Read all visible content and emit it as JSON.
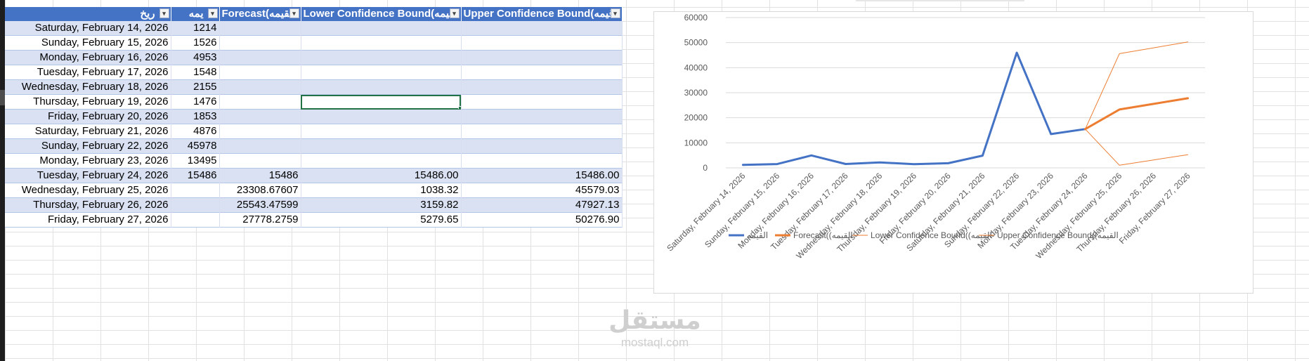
{
  "table": {
    "headers": [
      "ريخ",
      "يمه",
      "Forecast(لقيمه",
      "Lower Confidence Bound(قيمه",
      "Upper Confidence Bound(قيمه"
    ],
    "rows": [
      [
        "Saturday, February 14, 2026",
        "1214",
        "",
        "",
        ""
      ],
      [
        "Sunday, February 15, 2026",
        "1526",
        "",
        "",
        ""
      ],
      [
        "Monday, February 16, 2026",
        "4953",
        "",
        "",
        ""
      ],
      [
        "Tuesday, February 17, 2026",
        "1548",
        "",
        "",
        ""
      ],
      [
        "Wednesday, February 18, 2026",
        "2155",
        "",
        "",
        ""
      ],
      [
        "Thursday, February 19, 2026",
        "1476",
        "",
        "",
        ""
      ],
      [
        "Friday, February 20, 2026",
        "1853",
        "",
        "",
        ""
      ],
      [
        "Saturday, February 21, 2026",
        "4876",
        "",
        "",
        ""
      ],
      [
        "Sunday, February 22, 2026",
        "45978",
        "",
        "",
        ""
      ],
      [
        "Monday, February 23, 2026",
        "13495",
        "",
        "",
        ""
      ],
      [
        "Tuesday, February 24, 2026",
        "15486",
        "15486",
        "15486.00",
        "15486.00"
      ],
      [
        "Wednesday, February 25, 2026",
        "",
        "23308.67607",
        "1038.32",
        "45579.03"
      ],
      [
        "Thursday, February 26, 2026",
        "",
        "25543.47599",
        "3159.82",
        "47927.13"
      ],
      [
        "Friday, February 27, 2026",
        "",
        "27778.2759",
        "5279.65",
        "50276.90"
      ]
    ]
  },
  "watermark": {
    "logo": "مستقل",
    "text": "mostaql.com"
  },
  "chart_data": {
    "type": "line",
    "categories": [
      "Saturday, February 14, 2026",
      "Sunday, February 15, 2026",
      "Monday, February 16, 2026",
      "Tuesday, February 17, 2026",
      "Wednesday, February 18, 2026",
      "Thursday, February 19, 2026",
      "Friday, February 20, 2026",
      "Saturday, February 21, 2026",
      "Sunday, February 22, 2026",
      "Monday, February 23, 2026",
      "Tuesday, February 24, 2026",
      "Wednesday, February 25, 2026",
      "Thursday, February 26, 2026",
      "Friday, February 27, 2026"
    ],
    "ylim": [
      0,
      60000
    ],
    "yticks": [
      0,
      10000,
      20000,
      30000,
      40000,
      50000,
      60000
    ],
    "grid": true,
    "legend": "bottom",
    "series": [
      {
        "name": "القيمه",
        "color": "#4472c4",
        "width": 3,
        "values": [
          1214,
          1526,
          4953,
          1548,
          2155,
          1476,
          1853,
          4876,
          45978,
          13495,
          15486,
          null,
          null,
          null
        ]
      },
      {
        "name": "Forecast((القيمه",
        "color": "#ed7d31",
        "width": 3,
        "values": [
          null,
          null,
          null,
          null,
          null,
          null,
          null,
          null,
          null,
          null,
          15486,
          23308.67607,
          25543.47599,
          27778.2759
        ]
      },
      {
        "name": "Lower Confidence Bound((القيمه",
        "color": "#ed7d31",
        "width": 1,
        "values": [
          null,
          null,
          null,
          null,
          null,
          null,
          null,
          null,
          null,
          null,
          15486,
          1038.32,
          3159.82,
          5279.65
        ]
      },
      {
        "name": "Upper Confidence Bound((القيمه",
        "color": "#ed7d31",
        "width": 1,
        "values": [
          null,
          null,
          null,
          null,
          null,
          null,
          null,
          null,
          null,
          null,
          15486,
          45579.03,
          47927.13,
          50276.9
        ]
      }
    ]
  }
}
